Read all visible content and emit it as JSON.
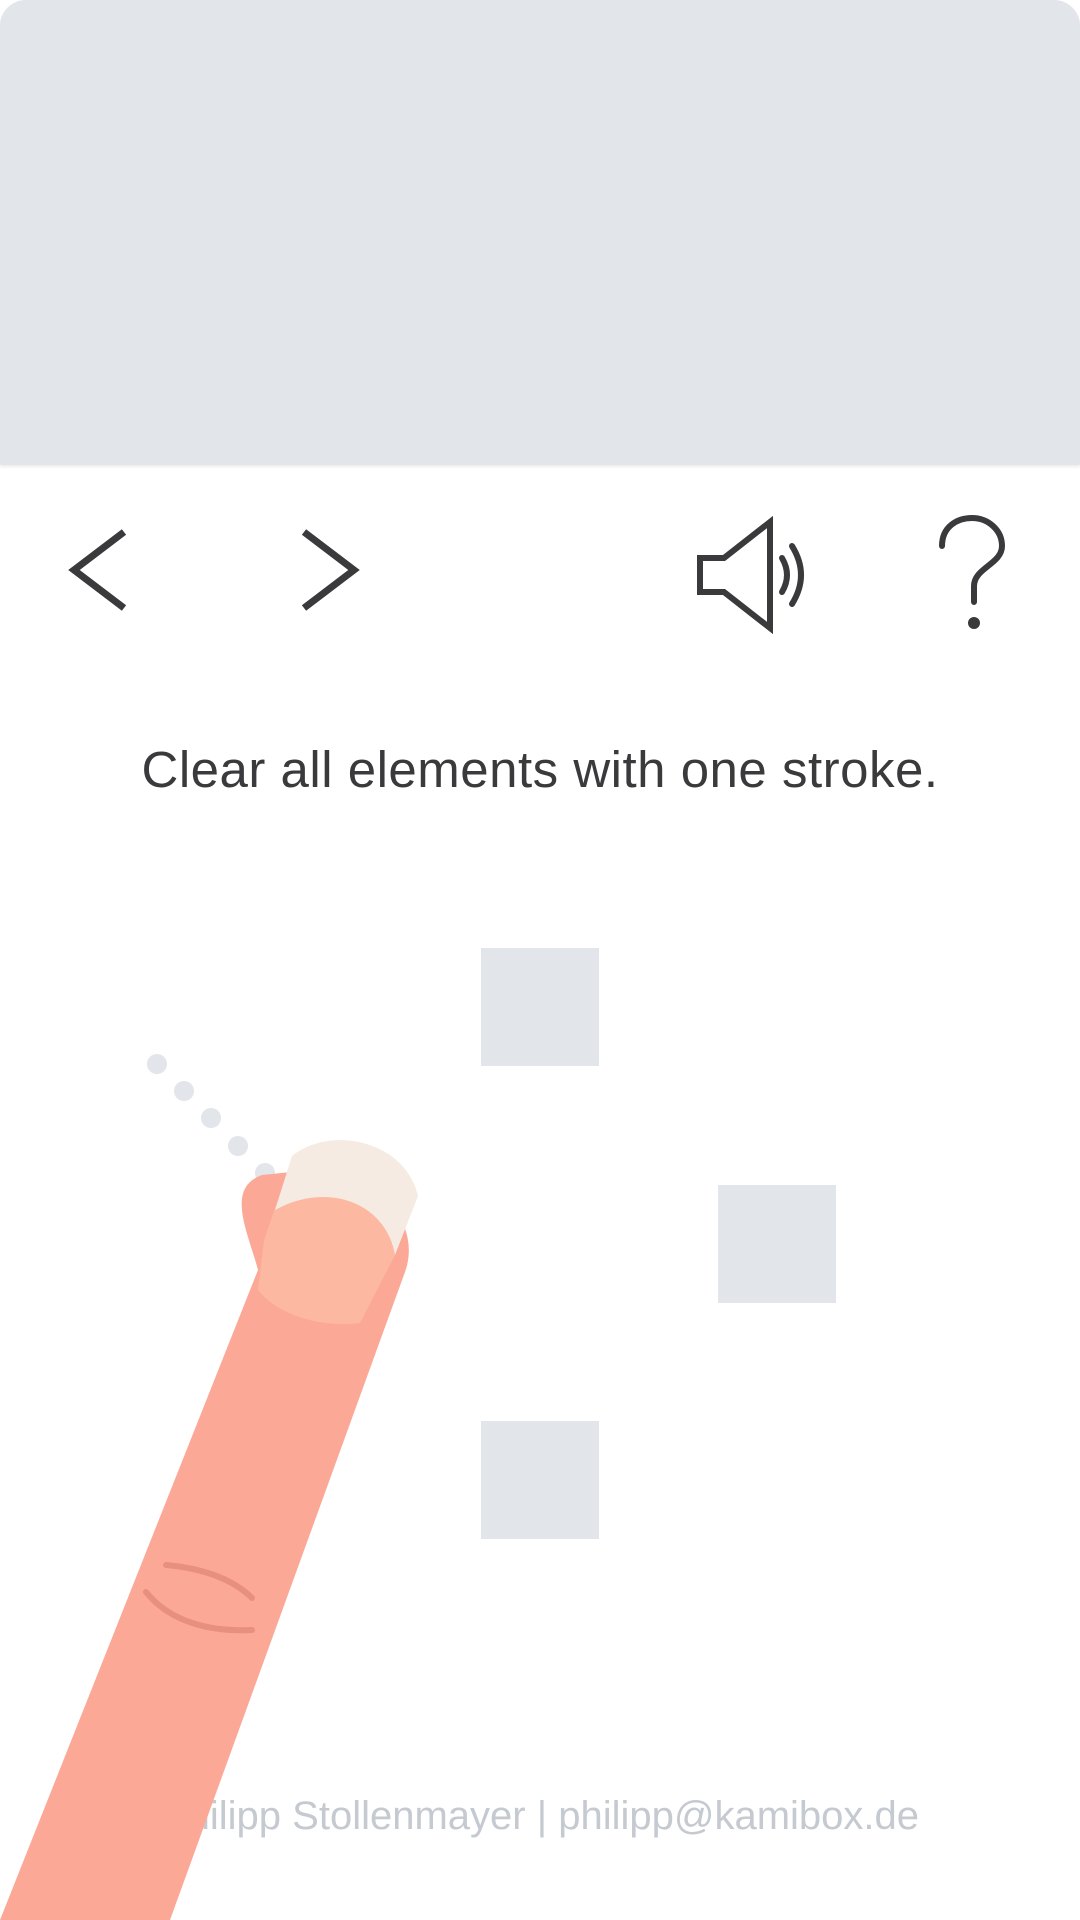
{
  "toolbar": {
    "back_icon": "chevron-left-icon",
    "forward_icon": "chevron-right-icon",
    "sound_icon": "speaker-icon",
    "help_icon": "question-mark-icon"
  },
  "instruction": "Clear all elements with one stroke.",
  "board": {
    "tiles": [
      {
        "id": 1
      },
      {
        "id": 2
      },
      {
        "id": 3
      }
    ]
  },
  "hint": {
    "illustration": "finger-swipe-hint"
  },
  "footer": {
    "credit": "Philipp Stollenmayer | philipp@kamibox.de"
  },
  "colors": {
    "panel": "#e2e5e9",
    "icon": "#3a3a3c",
    "tile": "#e2e5e9",
    "finger": "#fca897",
    "nail": "#f5ebe2",
    "footer_text": "#c5c9d0"
  }
}
